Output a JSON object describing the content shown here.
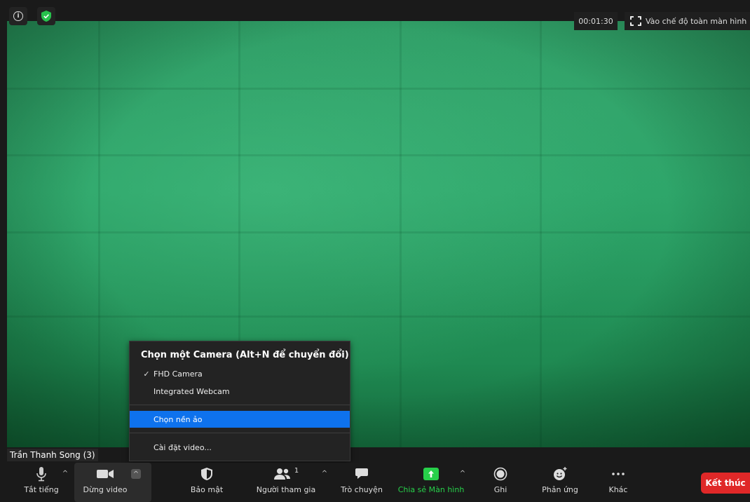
{
  "meeting": {
    "timer": "00:01:30",
    "fullscreen_label": "Vào chế độ toàn màn hình",
    "participant_name": "Trần Thanh Song (3)"
  },
  "camera_menu": {
    "header": "Chọn một Camera (Alt+N để chuyển đổi)",
    "cameras": [
      {
        "label": "FHD Camera",
        "checked": true
      },
      {
        "label": "Integrated Webcam",
        "checked": false
      }
    ],
    "virtual_background": "Chọn nền ảo",
    "video_settings": "Cài đặt video...",
    "check_mark": "✓"
  },
  "toolbar": {
    "mute": "Tắt tiếng",
    "stop_video": "Dừng video",
    "security": "Bảo mật",
    "participants": "Người tham gia",
    "participants_count": "1",
    "chat": "Trò chuyện",
    "share_screen": "Chia sẻ Màn hình",
    "record": "Ghi",
    "reactions": "Phản ứng",
    "more": "Khác",
    "end": "Kết thúc"
  },
  "colors": {
    "accent_blue": "#0e72ed",
    "share_green": "#27d04a",
    "end_red": "#e02828",
    "shield_green": "#27c24c"
  }
}
